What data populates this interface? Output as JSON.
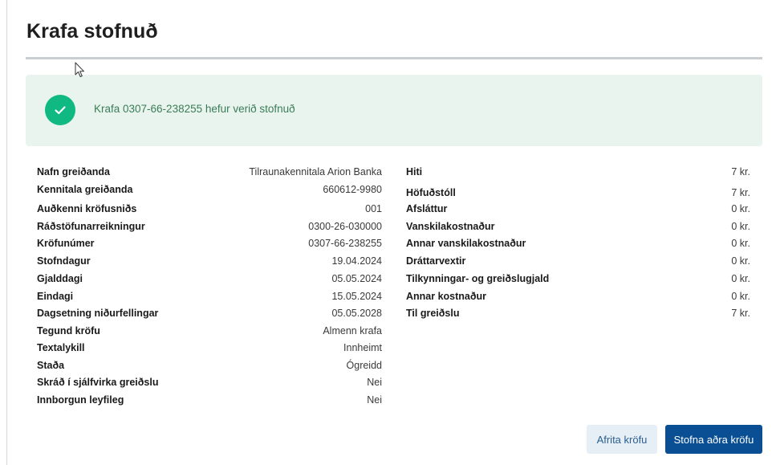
{
  "page": {
    "title": "Krafa stofnuð"
  },
  "alert": {
    "message": "Krafa 0307-66-238255 hefur verið stofnuð",
    "color": "#10b981"
  },
  "details_left": [
    {
      "label": "Nafn greiðanda",
      "value": "Tilraunakennitala Arion Banka"
    },
    {
      "label": "Kennitala greiðanda",
      "value": "660612-9980"
    },
    {
      "label": "Auðkenni kröfusniðs",
      "value": "001"
    },
    {
      "label": "Ráðstöfunarreikningur",
      "value": "0300-26-030000"
    },
    {
      "label": "Kröfunúmer",
      "value": "0307-66-238255"
    },
    {
      "label": "Stofndagur",
      "value": "19.04.2024"
    },
    {
      "label": "Gjalddagi",
      "value": "05.05.2024"
    },
    {
      "label": "Eindagi",
      "value": "15.05.2024"
    },
    {
      "label": "Dagsetning niðurfellingar",
      "value": "05.05.2028"
    },
    {
      "label": "Tegund kröfu",
      "value": "Almenn krafa"
    },
    {
      "label": "Textalykill",
      "value": "Innheimt"
    },
    {
      "label": "Staða",
      "value": "Ógreidd"
    },
    {
      "label": "Skráð í sjálfvirka greiðslu",
      "value": "Nei"
    },
    {
      "label": "Innborgun leyfileg",
      "value": "Nei"
    }
  ],
  "details_right": [
    {
      "label": "Hiti",
      "value": "7 kr."
    },
    {
      "label": "Höfuðstóll",
      "value": "7 kr."
    },
    {
      "label": "Afsláttur",
      "value": "0 kr."
    },
    {
      "label": "Vanskilakostnaður",
      "value": "0 kr."
    },
    {
      "label": "Annar vanskilakostnaður",
      "value": "0 kr."
    },
    {
      "label": "Dráttarvextir",
      "value": "0 kr."
    },
    {
      "label": "Tilkynningar- og greiðslugjald",
      "value": "0 kr."
    },
    {
      "label": "Annar kostnaður",
      "value": "0 kr."
    },
    {
      "label": "Til greiðslu",
      "value": "7 kr."
    }
  ],
  "actions": {
    "copy_label": "Afrita kröfu",
    "create_label": "Stofna aðra kröfu"
  },
  "icons": {
    "success": "check-circle-icon",
    "cursor": "mouse-pointer-icon"
  }
}
